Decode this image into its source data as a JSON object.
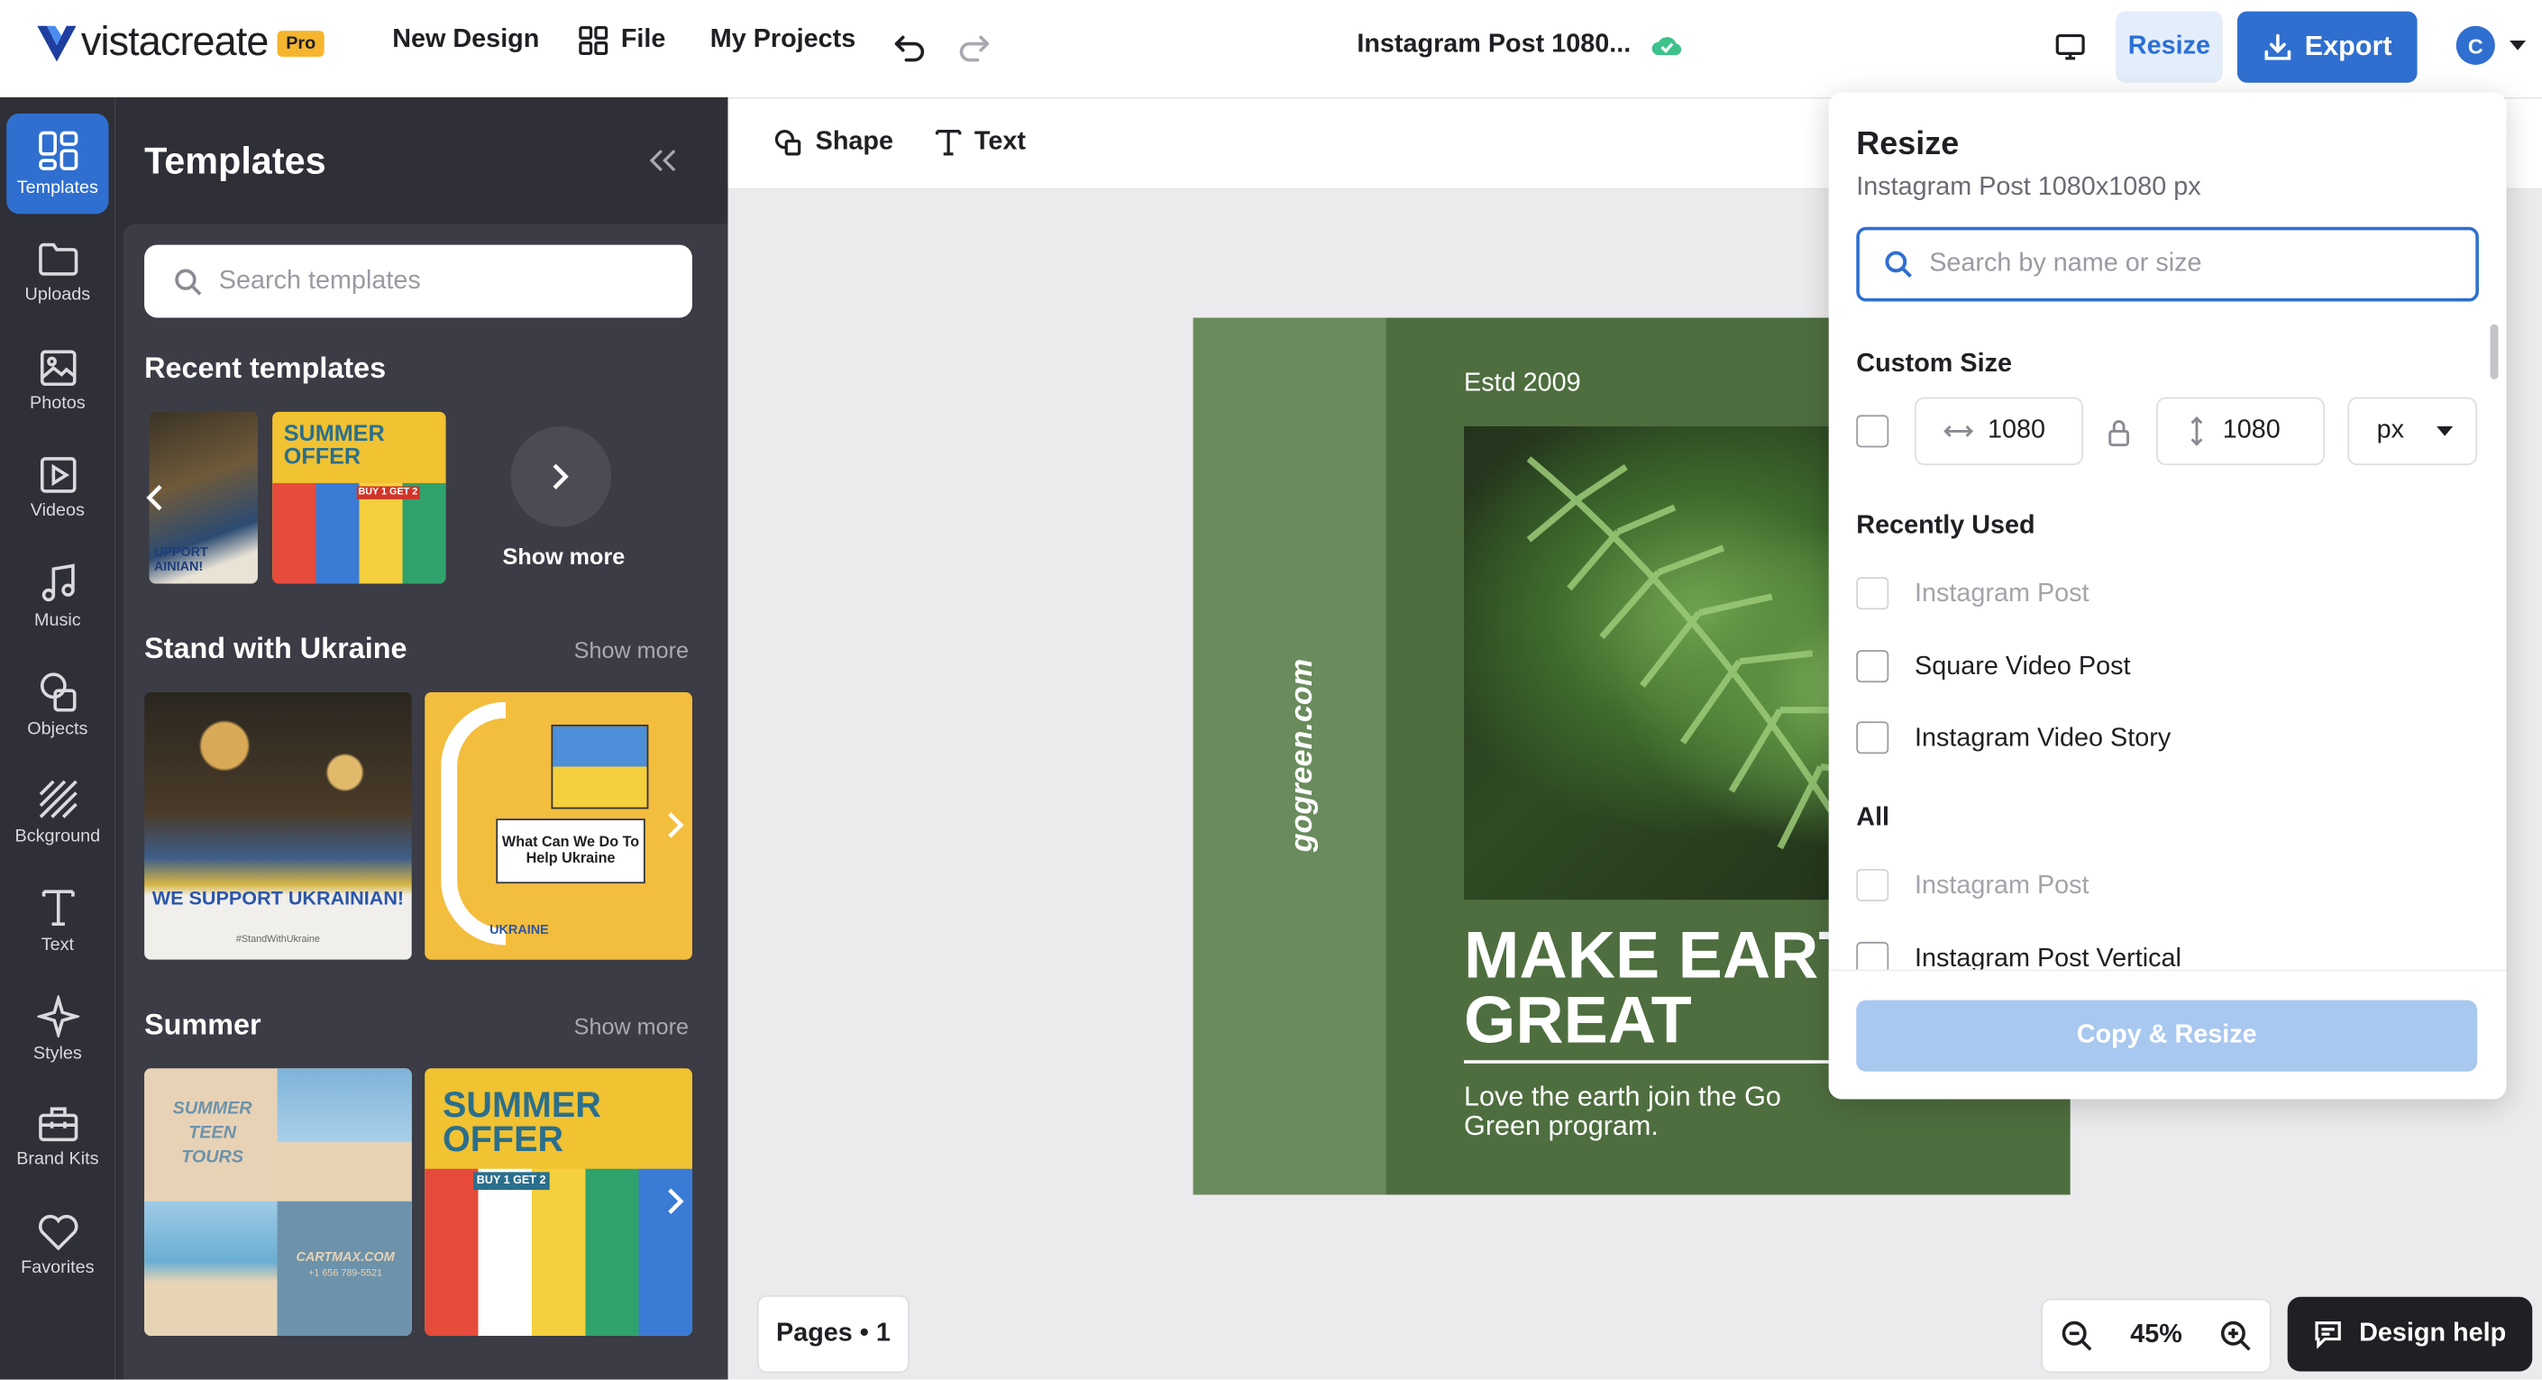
{
  "brand": {
    "logo": "vistacreate",
    "badge": "Pro"
  },
  "topbar": {
    "new_design": "New Design",
    "file": "File",
    "my_projects": "My Projects",
    "doc_title": "Instagram Post 1080...",
    "resize": "Resize",
    "export": "Export",
    "avatar_initial": "C"
  },
  "rail": {
    "items": [
      {
        "label": "Templates",
        "icon": "templates-icon"
      },
      {
        "label": "Uploads",
        "icon": "folder-icon"
      },
      {
        "label": "Photos",
        "icon": "photo-icon"
      },
      {
        "label": "Videos",
        "icon": "video-icon"
      },
      {
        "label": "Music",
        "icon": "music-icon"
      },
      {
        "label": "Objects",
        "icon": "objects-icon"
      },
      {
        "label": "Bckground",
        "icon": "background-icon"
      },
      {
        "label": "Text",
        "icon": "text-icon"
      },
      {
        "label": "Styles",
        "icon": "sparkle-icon"
      },
      {
        "label": "Brand Kits",
        "icon": "briefcase-icon"
      },
      {
        "label": "Favorites",
        "icon": "heart-icon"
      }
    ]
  },
  "templates_panel": {
    "title": "Templates",
    "search_placeholder": "Search templates",
    "recent_title": "Recent templates",
    "recent_show_more": "Show more",
    "ukraine_title": "Stand with Ukraine",
    "ukraine_show_more": "Show more",
    "summer_title": "Summer",
    "summer_show_more": "Show more",
    "thumbs": {
      "recent_1": "UPPORT AINIAN!",
      "summer_offer": "SUMMER OFFER",
      "buy_get": "BUY 1 GET 2",
      "we_support": "WE SUPPORT UKRAINIAN!",
      "hashtag": "#StandWithUkraine",
      "what_can_we_do": "What Can We Do To Help Ukraine",
      "ukraine_word": "UKRAINE",
      "summer_teen": "SUMMER TEEN TOURS",
      "cartmax": "CARTMAX.COM",
      "phone": "+1 656 789-5521"
    }
  },
  "toolbar": {
    "shape": "Shape",
    "text": "Text"
  },
  "design": {
    "side_text": "gogreen.com",
    "estd": "Estd 2009",
    "headline_1": "MAKE EART",
    "headline_2": "GREAT",
    "tagline_1": "Love the earth join the Go",
    "tagline_2": "Green program."
  },
  "bottom": {
    "pages": "Pages • 1",
    "zoom": "45%",
    "design_help": "Design help"
  },
  "resize_popup": {
    "title": "Resize",
    "subtitle": "Instagram Post 1080x1080 px",
    "search_placeholder": "Search by name or size",
    "custom_size": "Custom Size",
    "width": "1080",
    "height": "1080",
    "unit": "px",
    "recently_used": "Recently Used",
    "recent_options": [
      "Instagram Post",
      "Square Video Post",
      "Instagram Video Story"
    ],
    "all": "All",
    "all_options": [
      "Instagram Post",
      "Instagram Post Vertical"
    ],
    "copy_resize": "Copy & Resize"
  },
  "colors": {
    "accent": "#2f6fd0",
    "panel_bg": "#2e2f37",
    "design_green": "#4e6e3f",
    "strip_green": "#6a8b5c",
    "cloud_ok": "#3cc28b"
  }
}
